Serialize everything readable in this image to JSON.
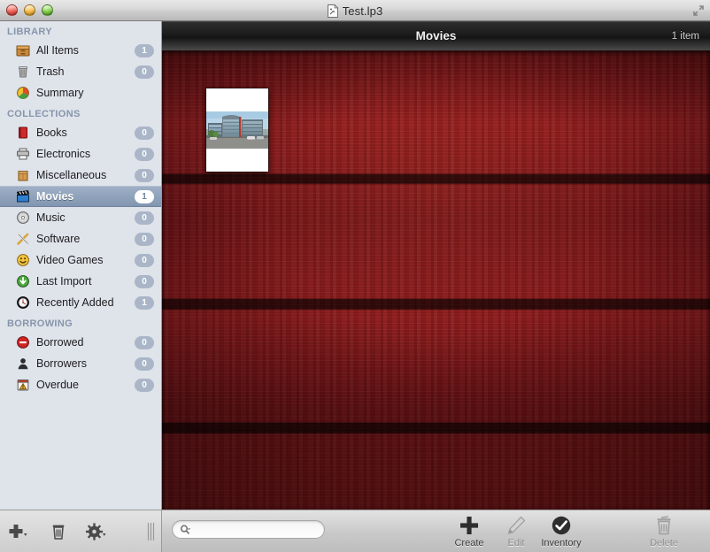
{
  "window": {
    "title": "Test.lp3",
    "doc_icon": "document-icon",
    "traffic_lights": [
      "close",
      "minimize",
      "zoom"
    ],
    "fullscreen_icon": "fullscreen-arrows-icon"
  },
  "sidebar": {
    "sections": [
      {
        "title": "LIBRARY",
        "items": [
          {
            "label": "All Items",
            "badge": "1",
            "icon": "archive-box-icon",
            "selected": false
          },
          {
            "label": "Trash",
            "badge": "0",
            "icon": "trash-icon",
            "selected": false
          },
          {
            "label": "Summary",
            "badge": "",
            "icon": "pie-chart-icon",
            "selected": false
          }
        ]
      },
      {
        "title": "COLLECTIONS",
        "items": [
          {
            "label": "Books",
            "badge": "0",
            "icon": "book-icon",
            "selected": false
          },
          {
            "label": "Electronics",
            "badge": "0",
            "icon": "printer-icon",
            "selected": false
          },
          {
            "label": "Miscellaneous",
            "badge": "0",
            "icon": "paper-bag-icon",
            "selected": false
          },
          {
            "label": "Movies",
            "badge": "1",
            "icon": "clapboard-icon",
            "selected": true
          },
          {
            "label": "Music",
            "badge": "0",
            "icon": "cd-disc-icon",
            "selected": false
          },
          {
            "label": "Software",
            "badge": "0",
            "icon": "pencil-ruler-icon",
            "selected": false
          },
          {
            "label": "Video Games",
            "badge": "0",
            "icon": "smiley-icon",
            "selected": false
          },
          {
            "label": "Last Import",
            "badge": "0",
            "icon": "download-arrow-icon",
            "selected": false
          },
          {
            "label": "Recently Added",
            "badge": "1",
            "icon": "clock-icon",
            "selected": false
          }
        ]
      },
      {
        "title": "BORROWING",
        "items": [
          {
            "label": "Borrowed",
            "badge": "0",
            "icon": "no-entry-icon",
            "selected": false
          },
          {
            "label": "Borrowers",
            "badge": "0",
            "icon": "person-icon",
            "selected": false
          },
          {
            "label": "Overdue",
            "badge": "0",
            "icon": "calendar-warning-icon",
            "selected": false
          }
        ]
      }
    ],
    "bottom_bar": {
      "add_icon": "plus-with-chevron-icon",
      "delete_icon": "trash-icon",
      "action_icon": "gear-with-chevron-icon",
      "grip_icon": "resize-grip-icon"
    }
  },
  "main": {
    "header": {
      "title": "Movies",
      "count": "1 item"
    },
    "items": [
      {
        "name": "movie-thumbnail",
        "photo": "modern-office-building-photo"
      }
    ],
    "background": "dark-red-wood-texture"
  },
  "toolbar": {
    "search": {
      "placeholder": "",
      "value": "",
      "icon": "search-magnifier-icon"
    },
    "buttons": [
      {
        "label": "Create",
        "icon": "plus-icon",
        "enabled": true
      },
      {
        "label": "Edit",
        "icon": "pencil-icon",
        "enabled": false
      },
      {
        "label": "Inventory",
        "icon": "check-circle-icon",
        "enabled": true
      },
      {
        "label": "Delete",
        "icon": "trash-icon",
        "enabled": false
      }
    ]
  },
  "colors": {
    "sidebar_bg": "#dfe3ea",
    "selection": "#8296b1",
    "badge": "#aab6c8",
    "wood": "#7e1417",
    "header_bar": "#1c1c1c"
  }
}
